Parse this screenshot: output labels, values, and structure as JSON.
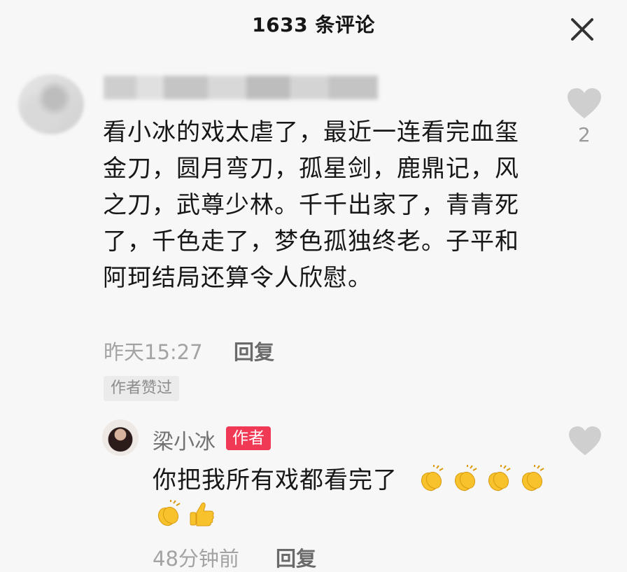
{
  "header": {
    "title": "1633 条评论"
  },
  "icons": {
    "close": "close-icon",
    "like": "heart-icon",
    "clap": "clapping-hands-emoji",
    "thumbs": "thumbs-up-emoji"
  },
  "colors": {
    "author_tag": "#f03a55",
    "heart": "#cfcfcf",
    "emoji": "#f7c22c"
  },
  "comment": {
    "text": "看小冰的戏太虐了，最近一连看完血玺金刀，圆月弯刀，孤星剑，鹿鼎记，风之刀，武尊少林。千千出家了，青青死了，千色走了，梦色孤独终老。子平和阿珂结局还算令人欣慰。",
    "time": "昨天15:27",
    "reply_label": "回复",
    "liked_by_author": "作者赞过",
    "like_count": "2"
  },
  "reply": {
    "username": "梁小冰",
    "author_tag": "作者",
    "text": "你把我所有戏都看完了",
    "time": "48分钟前",
    "reply_label": "回复"
  }
}
